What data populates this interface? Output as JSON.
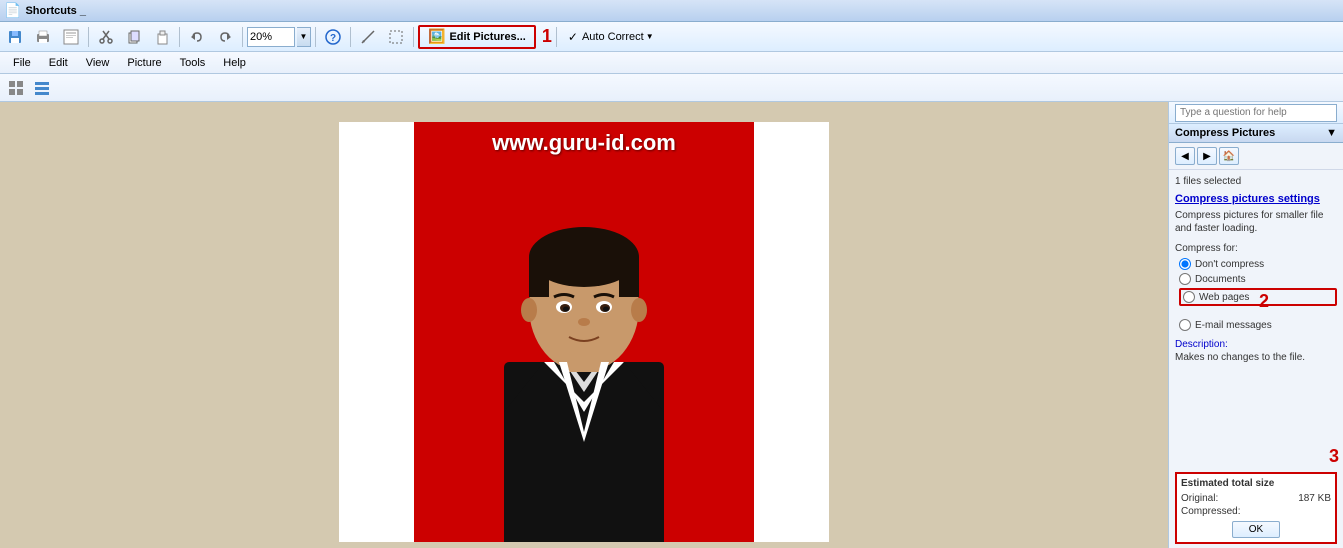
{
  "titlebar": {
    "text": "Shortcuts _"
  },
  "toolbar": {
    "zoom": "20%",
    "edit_pictures_label": "Edit Pictures...",
    "autocorrect_label": "Auto Correct",
    "step1_label": "1"
  },
  "menubar": {
    "items": [
      "File",
      "Edit",
      "View",
      "Picture",
      "Tools",
      "Help"
    ]
  },
  "help_bar": {
    "placeholder": "Type a question for help"
  },
  "right_panel": {
    "header": "Compress Pictures",
    "files_selected": "1 files selected",
    "compress_settings_link": "Compress pictures settings",
    "compress_desc": "Compress pictures for smaller file and faster loading.",
    "compress_for_label": "Compress for:",
    "radio_options": [
      {
        "label": "Don't compress",
        "value": "none",
        "checked": true
      },
      {
        "label": "Documents",
        "value": "documents",
        "checked": false
      },
      {
        "label": "Web pages",
        "value": "web",
        "checked": false,
        "highlighted": true
      },
      {
        "label": "E-mail messages",
        "value": "email",
        "checked": false
      }
    ],
    "description_label": "Description:",
    "description_text": "Makes no changes to the file.",
    "step2_label": "2",
    "estimated_title": "Estimated total size",
    "original_label": "Original:",
    "original_value": "187 KB",
    "compressed_label": "Compressed:",
    "compressed_value": "",
    "ok_button": "OK",
    "step3_label": "3"
  },
  "canvas": {
    "watermark": "www.guru-id.com",
    "bg_color": "#cc0000"
  }
}
